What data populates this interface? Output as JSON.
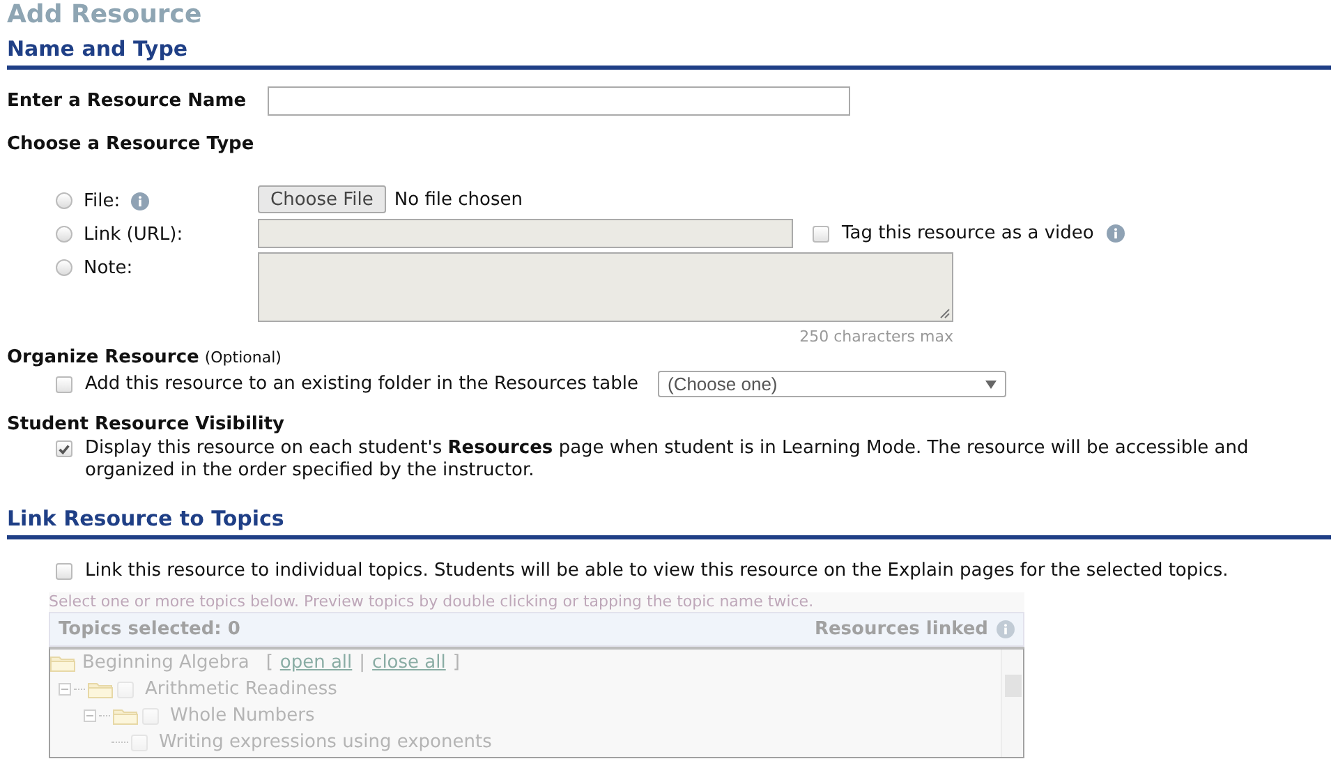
{
  "page_title": "Add Resource",
  "name_and_type": {
    "heading": "Name and Type",
    "name_label": "Enter a Resource Name",
    "type_label": "Choose a Resource Type",
    "types": [
      {
        "kind": "file",
        "label": "File:",
        "selected": false,
        "button": "Choose File",
        "status": "No file chosen"
      },
      {
        "kind": "link",
        "label": "Link (URL):",
        "selected": false,
        "video": {
          "label": "Tag this resource as a video",
          "checked": false
        }
      },
      {
        "kind": "note",
        "label": "Note:",
        "selected": false,
        "counter": "250 characters max"
      }
    ]
  },
  "organize": {
    "heading": "Organize Resource",
    "optional": "(Optional)",
    "label": "Add this resource to an existing folder in the Resources table",
    "checked": false,
    "select": "(Choose one)"
  },
  "visibility": {
    "heading": "Student Resource Visibility",
    "label": "Display this resource on each student's **Resources** page when student is in Learning Mode. The resource will be accessible and organized in the order specified by the instructor.",
    "checked": true
  },
  "link_topics": {
    "heading": "Link Resource to Topics",
    "label": "Link this resource to individual topics. Students will be able to view this resource on the Explain pages for the selected topics.",
    "checked": false,
    "hint": "Select one or more topics below. Preview topics by double clicking or tapping the topic name twice.",
    "topics_selected": "Topics selected: 0",
    "resources_linked": "Resources linked",
    "disabled": true,
    "tree": {
      "label": "Beginning Algebra",
      "bracket_open": "[",
      "open_all": "open all",
      "separator": "|",
      "close_all": "close all",
      "bracket_close": "]",
      "children": [
        {
          "label": "Arithmetic Readiness",
          "checked": false,
          "expanded": true,
          "children": [
            {
              "label": "Whole Numbers",
              "checked": false,
              "expanded": true,
              "children": [
                {
                  "label": "Writing expressions using exponents",
                  "checked": false
                }
              ]
            }
          ]
        }
      ]
    }
  }
}
